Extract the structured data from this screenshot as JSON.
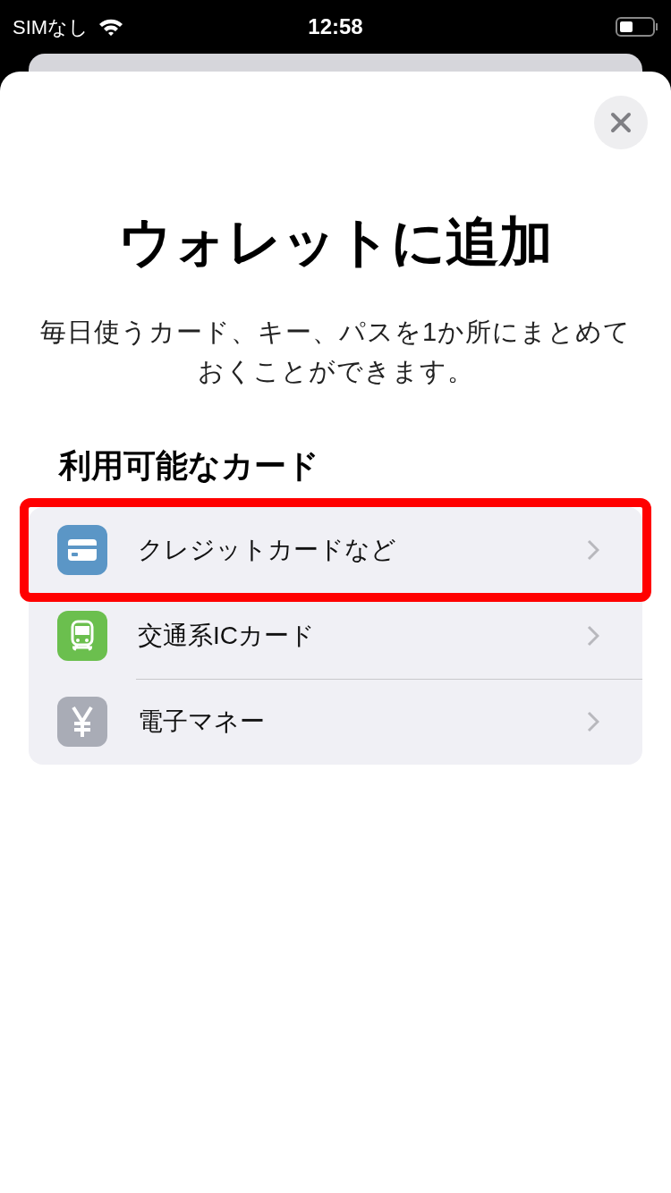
{
  "status_bar": {
    "carrier": "SIMなし",
    "time": "12:58"
  },
  "sheet": {
    "title": "ウォレットに追加",
    "description": "毎日使うカード、キー、パスを1か所にまとめておくことができます。",
    "section_title": "利用可能なカード",
    "items": [
      {
        "label": "クレジットカードなど",
        "kind": "card",
        "color": "#5b96c6",
        "highlighted": true
      },
      {
        "label": "交通系ICカード",
        "kind": "train",
        "color": "#6bbf4e",
        "highlighted": false
      },
      {
        "label": "電子マネー",
        "kind": "yen",
        "color": "#a9acb6",
        "highlighted": false
      }
    ]
  }
}
